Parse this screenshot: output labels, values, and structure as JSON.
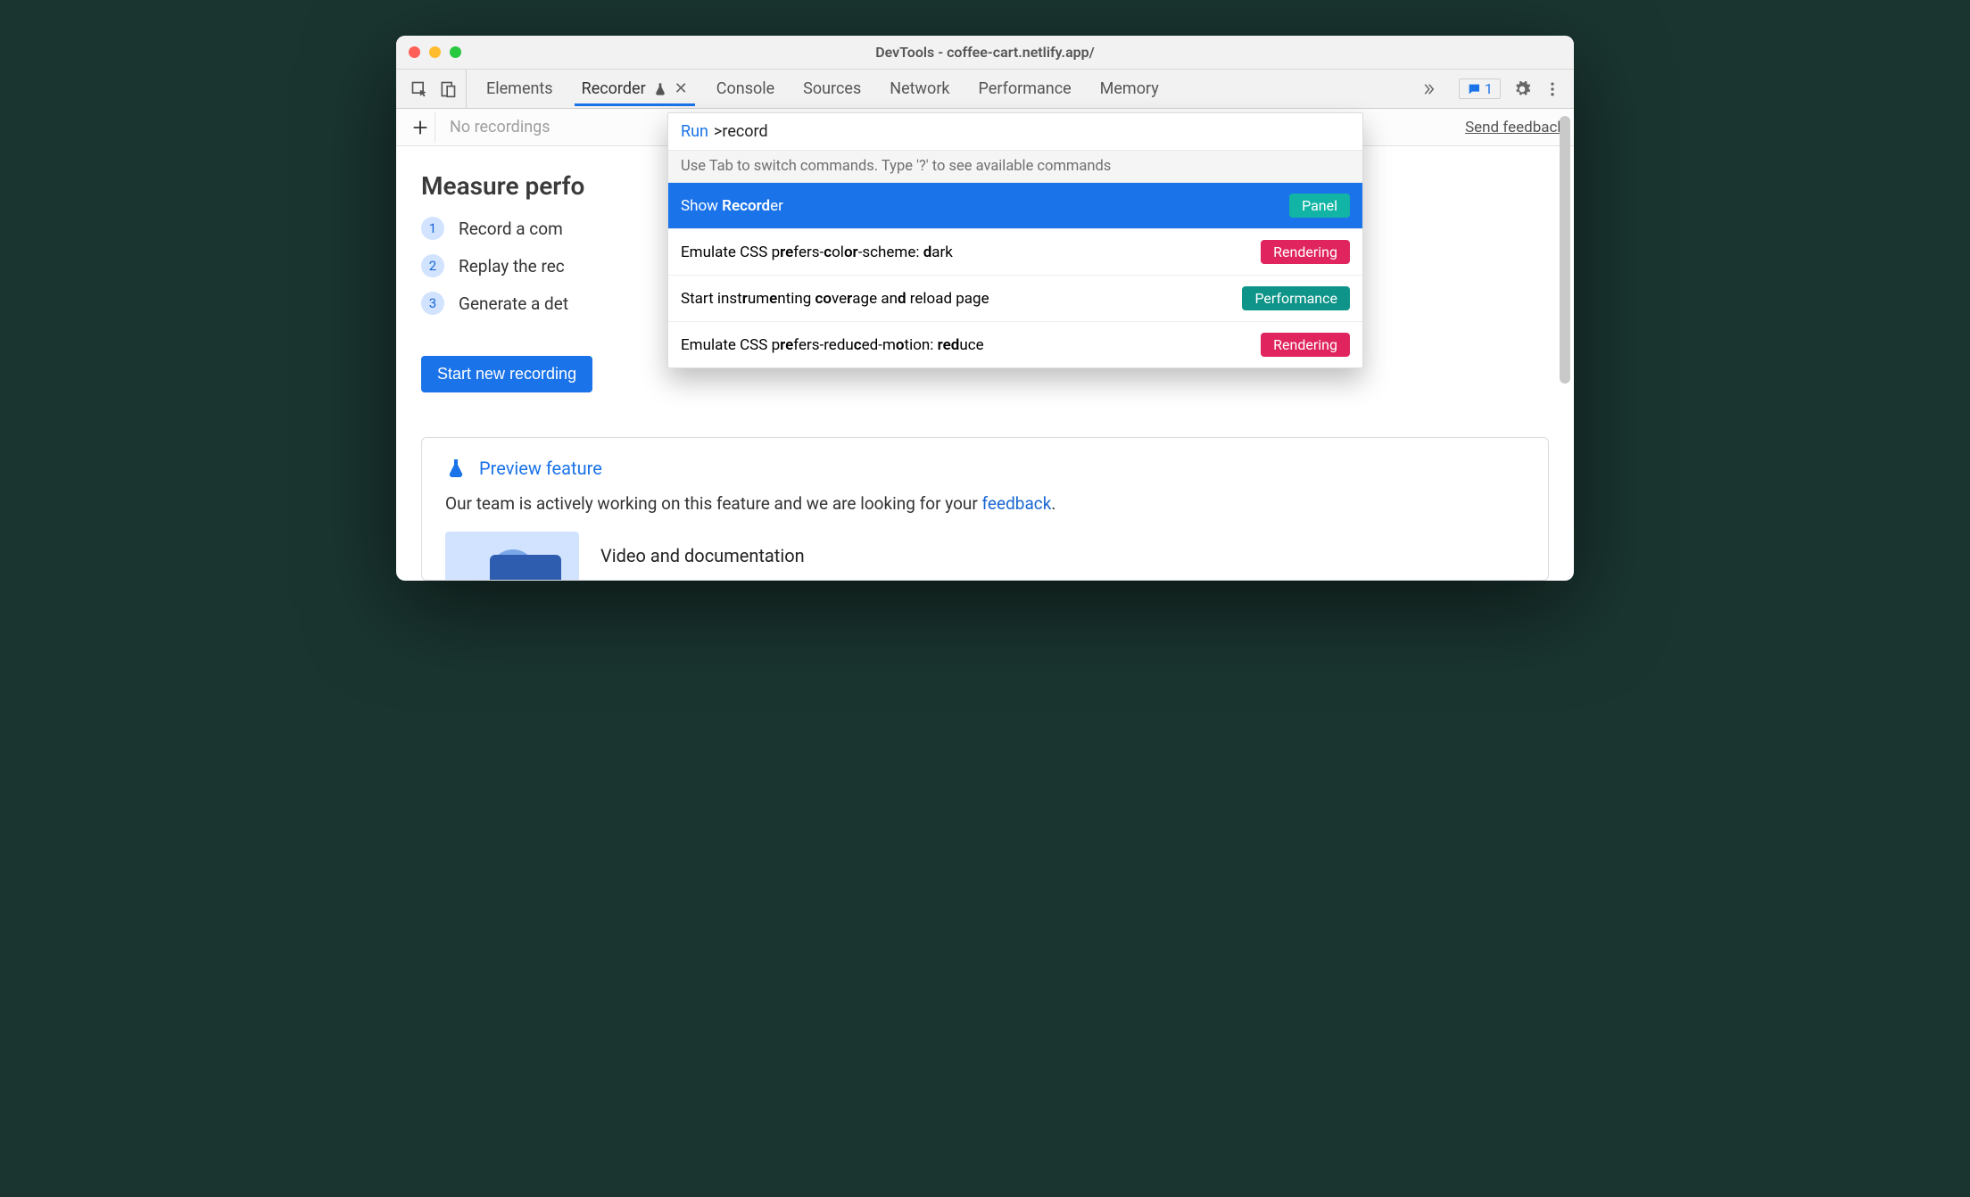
{
  "window": {
    "title": "DevTools - coffee-cart.netlify.app/"
  },
  "tabs": {
    "items": [
      "Elements",
      "Recorder",
      "Console",
      "Sources",
      "Network",
      "Performance",
      "Memory"
    ],
    "activeIndex": 1
  },
  "issues_count": "1",
  "subbar": {
    "no_recordings": "No recordings",
    "send_feedback": "Send feedback"
  },
  "main": {
    "heading": "Measure perfo",
    "steps": [
      "Record a com",
      "Replay the rec",
      "Generate a det"
    ],
    "start_button": "Start new recording",
    "preview_title": "Preview feature",
    "preview_text_before": "Our team is actively working on this feature and we are looking for your ",
    "preview_link": "feedback",
    "preview_text_after": ".",
    "videodoc_label": "Video and documentation"
  },
  "palette": {
    "run_label": "Run",
    "prefix": ">",
    "query": "record",
    "hint": "Use Tab to switch commands. Type '?' to see available commands",
    "items": [
      {
        "label_html": "Show <span class='match'>Record</span>er",
        "badge": "Panel",
        "badge_class": "badge-panel",
        "selected": true
      },
      {
        "label_html": "Emulate CSS p<span class='match'>re</span>fers-<span class='match'>c</span>ol<span class='match'>or</span>-scheme: <span class='match'>d</span>ark",
        "badge": "Rendering",
        "badge_class": "badge-rendering"
      },
      {
        "label_html": "Start inst<span class='match'>r</span>um<span class='match'>e</span>nting <span class='match'>co</span>ve<span class='match'>r</span>age an<span class='match'>d</span> reload page",
        "badge": "Performance",
        "badge_class": "badge-performance"
      },
      {
        "label_html": "Emulate CSS p<span class='match'>re</span>fers-redu<span class='match'>c</span>ed-m<span class='match'>o</span>tion: <span class='match'>red</span>uce",
        "badge": "Rendering",
        "badge_class": "badge-rendering"
      }
    ]
  }
}
